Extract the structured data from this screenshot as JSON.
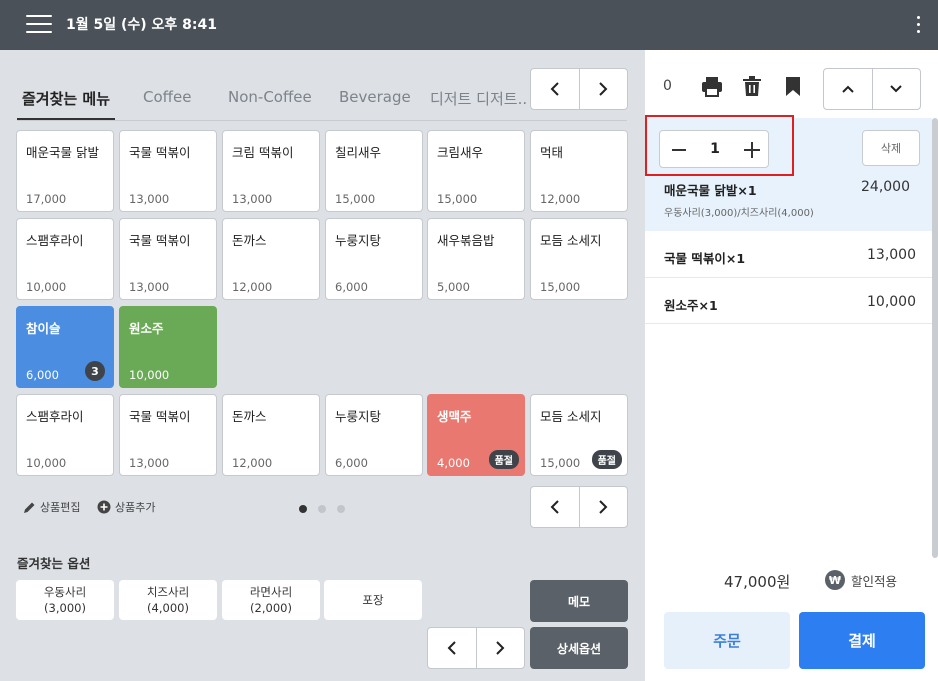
{
  "header": {
    "datetime": "1월 5일 (수) 오후 8:41"
  },
  "tabs": [
    "즐겨찾는 메뉴",
    "Coffee",
    "Non-Coffee",
    "Beverage",
    "디저트 디저트.."
  ],
  "menu_rows": [
    [
      {
        "name": "매운국물 닭발",
        "price": "17,000"
      },
      {
        "name": "국물 떡볶이",
        "price": "13,000"
      },
      {
        "name": "크림 떡볶이",
        "price": "13,000"
      },
      {
        "name": "칠리새우",
        "price": "15,000"
      },
      {
        "name": "크림새우",
        "price": "15,000"
      },
      {
        "name": "먹태",
        "price": "12,000"
      }
    ],
    [
      {
        "name": "스팸후라이",
        "price": "10,000"
      },
      {
        "name": "국물 떡볶이",
        "price": "13,000"
      },
      {
        "name": "돈까스",
        "price": "12,000"
      },
      {
        "name": "누룽지탕",
        "price": "6,000"
      },
      {
        "name": "새우볶음밥",
        "price": "5,000"
      },
      {
        "name": "모듬 소세지",
        "price": "15,000"
      }
    ],
    [
      {
        "name": "참이슬",
        "price": "6,000",
        "count": "3"
      },
      {
        "name": "원소주",
        "price": "10,000"
      }
    ],
    [
      {
        "name": "스팸후라이",
        "price": "10,000"
      },
      {
        "name": "국물 떡볶이",
        "price": "13,000"
      },
      {
        "name": "돈까스",
        "price": "12,000"
      },
      {
        "name": "누룽지탕",
        "price": "6,000"
      },
      {
        "name": "생맥주",
        "price": "4,000",
        "badge": "품절"
      },
      {
        "name": "모듬 소세지",
        "price": "15,000",
        "badge": "품절"
      }
    ]
  ],
  "tools": {
    "edit": "상품편집",
    "add": "상품추가"
  },
  "options": {
    "title": "즐겨찾는 옵션",
    "items": [
      {
        "name": "우동사리",
        "price": "(3,000)"
      },
      {
        "name": "치즈사리",
        "price": "(4,000)"
      },
      {
        "name": "라면사리",
        "price": "(2,000)"
      },
      {
        "name": "포장",
        "price": ""
      }
    ],
    "memo": "메모",
    "detail": "상세옵션"
  },
  "order": {
    "count": "0",
    "quantity": "1",
    "delete_label": "삭제",
    "items": [
      {
        "name": "매운국물 닭발×1",
        "price": "24,000",
        "options": "우동사리(3,000)/치즈사리(4,000)"
      },
      {
        "name": "국물 떡볶이×1",
        "price": "13,000"
      },
      {
        "name": "원소주×1",
        "price": "10,000"
      }
    ],
    "total": "47,000원",
    "discount_label": "할인적용",
    "order_label": "주문",
    "pay_label": "결제"
  },
  "colors": {
    "topbar": "#4a5159",
    "soju_card": "#4b8de0",
    "wonsoju_card": "#6aaa56",
    "beer_card": "#e87870",
    "pay_button": "#2d7ef0",
    "highlight": "#e02020"
  }
}
